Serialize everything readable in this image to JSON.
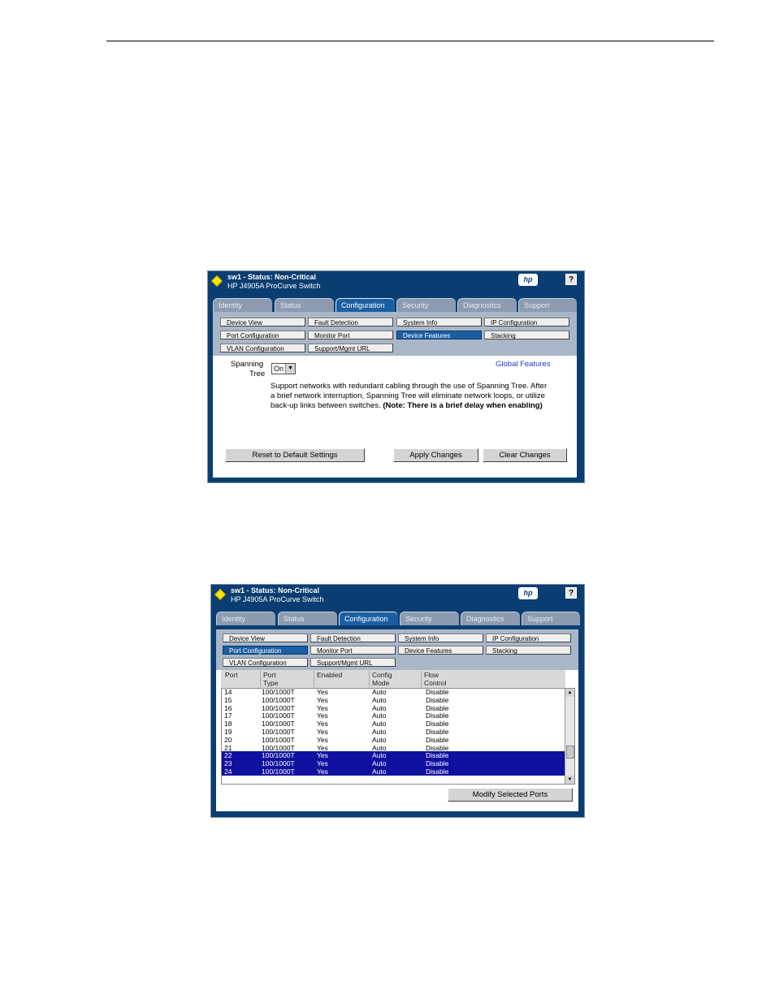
{
  "shot1": {
    "title": "sw1 - Status: Non-Critical",
    "subtitle": "HP J4905A ProCurve Switch",
    "hp_logo": "hp",
    "help": "?",
    "tabs": [
      "Identity",
      "Status",
      "Configuration",
      "Security",
      "Diagnostics",
      "Support"
    ],
    "active_tab": "Configuration",
    "subnav": [
      "Device View",
      "Fault Detection",
      "System Info",
      "IP Configuration",
      "Port Configuration",
      "Monitor Port",
      "Device Features",
      "Stacking",
      "VLAN Configuration",
      "Support/Mgmt URL"
    ],
    "selected_subnav": "Device Features",
    "spanning_label_1": "Spanning",
    "spanning_label_2": "Tree",
    "spanning_value": "On",
    "global_features": "Global Features",
    "desc_line1": "Support networks with redundant cabling through the use of Spanning Tree. After",
    "desc_line2": "a brief network interruption, Spanning Tree will eliminate network loops, or utilize",
    "desc_line3": "back-up links between switches.",
    "desc_note": "(Note: There is a brief delay when enabling)",
    "btn_reset": "Reset to Default Settings",
    "btn_apply": "Apply Changes",
    "btn_clear": "Clear Changes"
  },
  "shot2": {
    "title": "sw1 - Status: Non-Critical",
    "subtitle": "HP J4905A ProCurve Switch",
    "hp_logo": "hp",
    "help": "?",
    "tabs": [
      "Identity",
      "Status",
      "Configuration",
      "Security",
      "Diagnostics",
      "Support"
    ],
    "active_tab": "Configuration",
    "subnav": [
      "Device View",
      "Fault Detection",
      "System Info",
      "IP Configuration",
      "Port Configuration",
      "Monitor Port",
      "Device Features",
      "Stacking",
      "VLAN Configuration",
      "Support/Mgmt URL"
    ],
    "selected_subnav": "Port Configuration",
    "columns": [
      {
        "l1": "Port",
        "l2": ""
      },
      {
        "l1": "Port",
        "l2": "Type"
      },
      {
        "l1": "Enabled",
        "l2": ""
      },
      {
        "l1": "Config",
        "l2": "Mode"
      },
      {
        "l1": "Flow",
        "l2": "Control"
      }
    ],
    "rows": [
      {
        "port": "14",
        "type": "100/1000T",
        "enabled": "Yes",
        "mode": "Auto",
        "flow": "Disable",
        "selected": false
      },
      {
        "port": "15",
        "type": "100/1000T",
        "enabled": "Yes",
        "mode": "Auto",
        "flow": "Disable",
        "selected": false
      },
      {
        "port": "16",
        "type": "100/1000T",
        "enabled": "Yes",
        "mode": "Auto",
        "flow": "Disable",
        "selected": false
      },
      {
        "port": "17",
        "type": "100/1000T",
        "enabled": "Yes",
        "mode": "Auto",
        "flow": "Disable",
        "selected": false
      },
      {
        "port": "18",
        "type": "100/1000T",
        "enabled": "Yes",
        "mode": "Auto",
        "flow": "Disable",
        "selected": false
      },
      {
        "port": "19",
        "type": "100/1000T",
        "enabled": "Yes",
        "mode": "Auto",
        "flow": "Disable",
        "selected": false
      },
      {
        "port": "20",
        "type": "100/1000T",
        "enabled": "Yes",
        "mode": "Auto",
        "flow": "Disable",
        "selected": false
      },
      {
        "port": "21",
        "type": "100/1000T",
        "enabled": "Yes",
        "mode": "Auto",
        "flow": "Disable",
        "selected": false
      },
      {
        "port": "22",
        "type": "100/1000T",
        "enabled": "Yes",
        "mode": "Auto",
        "flow": "Disable",
        "selected": true
      },
      {
        "port": "23",
        "type": "100/1000T",
        "enabled": "Yes",
        "mode": "Auto",
        "flow": "Disable",
        "selected": true
      },
      {
        "port": "24",
        "type": "100/1000T",
        "enabled": "Yes",
        "mode": "Auto",
        "flow": "Disable",
        "selected": true
      }
    ],
    "btn_modify": "Modify Selected Ports"
  },
  "colors": {
    "frame": "#0a3e72",
    "highlight": "#1010a0",
    "link": "#1a3ccf"
  }
}
